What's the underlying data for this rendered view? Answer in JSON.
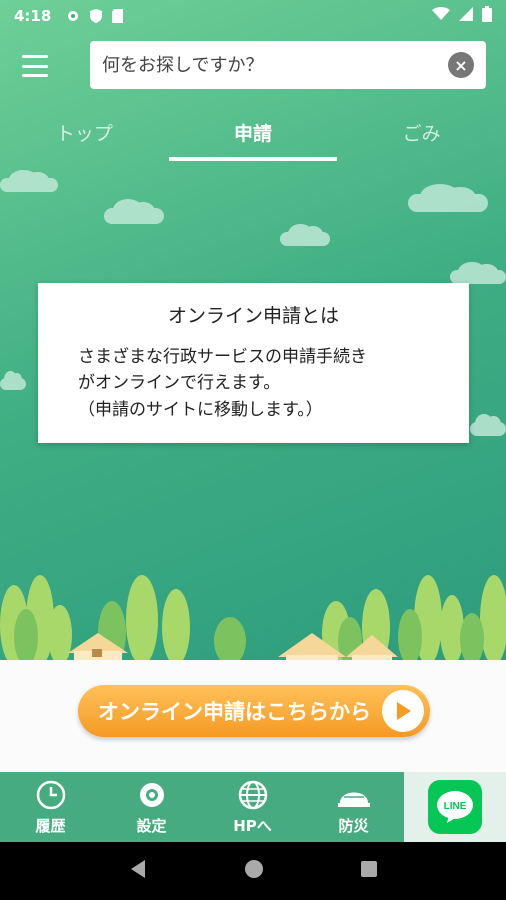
{
  "status_bar": {
    "time": "4:18"
  },
  "search": {
    "placeholder": "何をお探しですか？"
  },
  "tabs": [
    {
      "label": "トップ",
      "active": false
    },
    {
      "label": "申請",
      "active": true
    },
    {
      "label": "ごみ",
      "active": false
    }
  ],
  "info_card": {
    "title": "オンライン申請とは",
    "lines": [
      "さまざまな行政サービスの申請手続き",
      "がオンラインで行えます。",
      "（申請のサイトに移動します。）"
    ]
  },
  "cta": {
    "label": "オンライン申請はこちらから"
  },
  "bottom_nav": {
    "items": [
      {
        "label": "履歴",
        "icon": "clock-icon"
      },
      {
        "label": "設定",
        "icon": "settings-icon"
      },
      {
        "label": "HPへ",
        "icon": "globe-icon"
      },
      {
        "label": "防災",
        "icon": "helmet-icon"
      }
    ],
    "line_label": "LINE"
  },
  "colors": {
    "accent": "#47ab80",
    "cta_orange": "#f59a23",
    "line_green": "#06c755"
  }
}
